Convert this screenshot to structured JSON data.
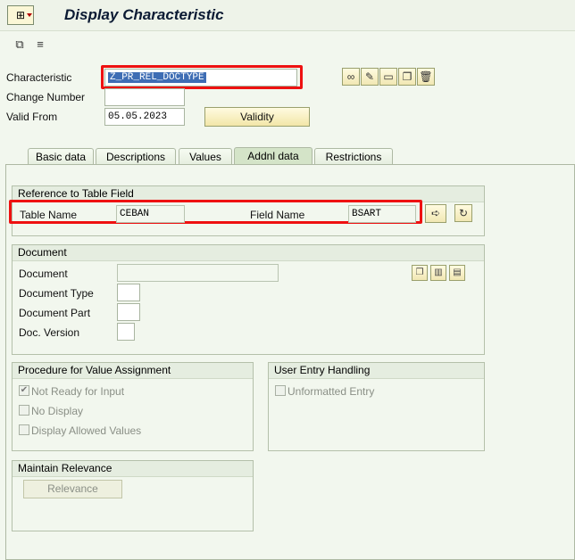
{
  "header": {
    "title": "Display Characteristic",
    "app_icon": "transaction-icon"
  },
  "toolbar": {
    "icons": [
      "other-object-icon",
      "hierarchy-icon"
    ]
  },
  "form": {
    "characteristic_label": "Characteristic",
    "characteristic_value": "Z_PR_REL_DOCTYPE",
    "change_number_label": "Change Number",
    "change_number_value": "",
    "valid_from_label": "Valid From",
    "valid_from_value": "05.05.2023",
    "validity_button": "Validity",
    "action_icons": [
      "glasses-icon",
      "pencil-icon",
      "new-document-icon",
      "copy-icon",
      "delete-icon"
    ]
  },
  "tabs": [
    {
      "label": "Basic data",
      "active": false
    },
    {
      "label": "Descriptions",
      "active": false
    },
    {
      "label": "Values",
      "active": false
    },
    {
      "label": "Addnl data",
      "active": true
    },
    {
      "label": "Restrictions",
      "active": false
    }
  ],
  "reference": {
    "title": "Reference to Table Field",
    "table_name_label": "Table Name",
    "table_name_value": "CEBAN",
    "field_name_label": "Field Name",
    "field_name_value": "BSART"
  },
  "document": {
    "title": "Document",
    "document_label": "Document",
    "document_type_label": "Document Type",
    "document_part_label": "Document Part",
    "doc_version_label": "Doc. Version"
  },
  "procedure": {
    "title": "Procedure for Value Assignment",
    "not_ready_label": "Not Ready for Input",
    "not_ready_checked": true,
    "no_display_label": "No Display",
    "display_allowed_label": "Display Allowed Values"
  },
  "user_entry": {
    "title": "User Entry Handling",
    "unformatted_label": "Unformatted Entry"
  },
  "relevance": {
    "title": "Maintain Relevance",
    "button_label": "Relevance"
  },
  "colors": {
    "highlight": "#e11111",
    "selection": "#3e6db4",
    "background": "#f2f7ee"
  }
}
